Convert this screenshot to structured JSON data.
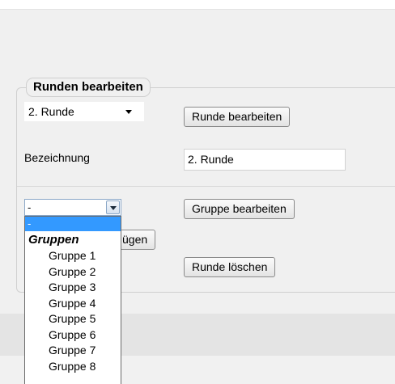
{
  "section": {
    "legend": "Runden bearbeiten"
  },
  "runde_select": {
    "value": "2. Runde"
  },
  "buttons": {
    "runde_bearbeiten": "Runde bearbeiten",
    "gruppe_bearbeiten": "Gruppe bearbeiten",
    "hinzufuegen_partial": "ügen",
    "runde_loeschen": "Runde löschen"
  },
  "bezeichnung": {
    "label": "Bezeichnung",
    "value": "2. Runde"
  },
  "gruppe_select": {
    "value": "-",
    "dropdown": {
      "selected_option": "-",
      "group_label": "Gruppen",
      "options": [
        "Gruppe 1",
        "Gruppe 2",
        "Gruppe 3",
        "Gruppe 4",
        "Gruppe 5",
        "Gruppe 6",
        "Gruppe 7",
        "Gruppe 8"
      ]
    }
  }
}
